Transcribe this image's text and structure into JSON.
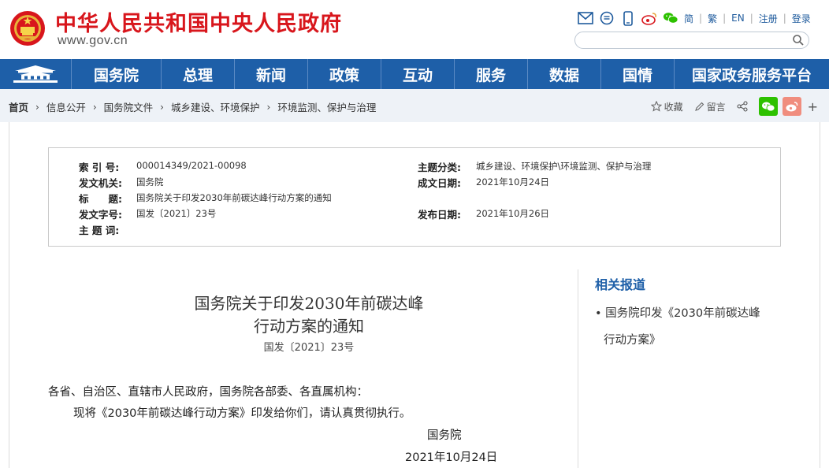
{
  "header": {
    "site_title": "中华人民共和国中央人民政府",
    "site_url": "www.gov.cn",
    "lang_simplified": "简",
    "lang_traditional": "繁",
    "lang_english": "EN",
    "register": "注册",
    "login": "登录",
    "search_placeholder": ""
  },
  "nav": {
    "items": [
      {
        "label": "国务院"
      },
      {
        "label": "总理"
      },
      {
        "label": "新闻"
      },
      {
        "label": "政策"
      },
      {
        "label": "互动"
      },
      {
        "label": "服务"
      },
      {
        "label": "数据"
      },
      {
        "label": "国情"
      },
      {
        "label": "国家政务服务平台"
      }
    ]
  },
  "breadcrumb": {
    "items": [
      "首页",
      "信息公开",
      "国务院文件",
      "城乡建设、环境保护",
      "环境监测、保护与治理"
    ]
  },
  "share": {
    "favorite": "收藏",
    "comment": "留言",
    "more": "+"
  },
  "info": {
    "index_no_label": "索 引 号:",
    "index_no": "000014349/2021-00098",
    "issuer_label": "发文机关:",
    "issuer": "国务院",
    "title_label": "标　　题:",
    "title": "国务院关于印发2030年前碳达峰行动方案的通知",
    "doc_no_label": "发文字号:",
    "doc_no": "国发〔2021〕23号",
    "keywords_label": "主 题 词:",
    "keywords": "",
    "category_label": "主题分类:",
    "category": "城乡建设、环境保护\\环境监测、保护与治理",
    "written_label": "成文日期:",
    "written_date": "2021年10月24日",
    "published_label": "发布日期:",
    "published_date": "2021年10月26日"
  },
  "article": {
    "title_line1": "国务院关于印发2030年前碳达峰",
    "title_line2": "行动方案的通知",
    "doc_number": "国发〔2021〕23号",
    "salutation": "各省、自治区、直辖市人民政府，国务院各部委、各直属机构：",
    "body": "现将《2030年前碳达峰行动方案》印发给你们，请认真贯彻执行。",
    "signature": "国务院",
    "date": "2021年10月24日"
  },
  "related": {
    "title": "相关报道",
    "items": [
      {
        "line1": "国务院印发《2030年前碳达峰",
        "line2": "行动方案》"
      }
    ]
  },
  "colors": {
    "brand_red": "#d8161c",
    "nav_blue": "#1e5fa8",
    "breadcrumb_bg": "#eef2f7",
    "wechat_green": "#2dc100",
    "weibo_orange": "#f08d7e"
  }
}
